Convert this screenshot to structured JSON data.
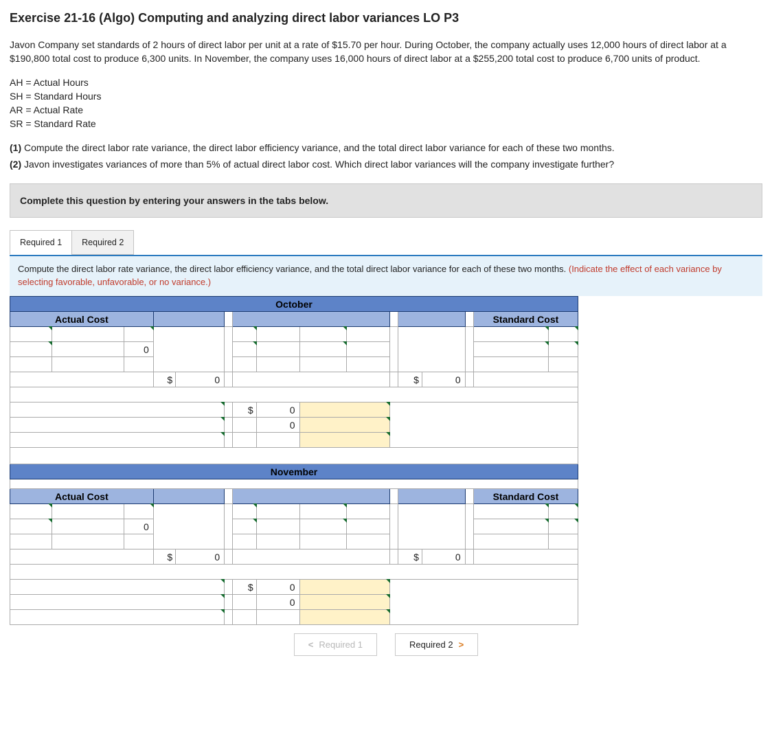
{
  "title": "Exercise 21-16 (Algo) Computing and analyzing direct labor variances LO P3",
  "intro": "Javon Company set standards of 2 hours of direct labor per unit at a rate of $15.70 per hour. During October, the company actually uses 12,000 hours of direct labor at a $190,800 total cost to produce 6,300 units. In November, the company uses 16,000 hours of direct labor at a $255,200 total cost to produce 6,700 units of product.",
  "defs": {
    "ah": "AH = Actual Hours",
    "sh": "SH = Standard Hours",
    "ar": "AR = Actual Rate",
    "sr": "SR = Standard Rate"
  },
  "q1_prefix": "(1)",
  "q1": " Compute the direct labor rate variance, the direct labor efficiency variance, and the total direct labor variance for each of these two months.",
  "q2_prefix": "(2)",
  "q2": " Javon investigates variances of more than 5% of actual direct labor cost. Which direct labor variances will the company investigate further?",
  "graybox": "Complete this question by entering your answers in the tabs below.",
  "tabs": {
    "t1": "Required 1",
    "t2": "Required 2"
  },
  "instr": "Compute the direct labor rate variance, the direct labor efficiency variance, and the total direct labor variance for each of these two months. ",
  "instr_hint": "(Indicate the effect of each variance by selecting favorable, unfavorable, or no variance.)",
  "months": {
    "oct": "October",
    "nov": "November"
  },
  "cols": {
    "ac": "Actual Cost",
    "sc": "Standard Cost"
  },
  "vals": {
    "zero": "0",
    "dollar": "$"
  },
  "nav": {
    "prev": "Required 1",
    "next": "Required 2"
  }
}
